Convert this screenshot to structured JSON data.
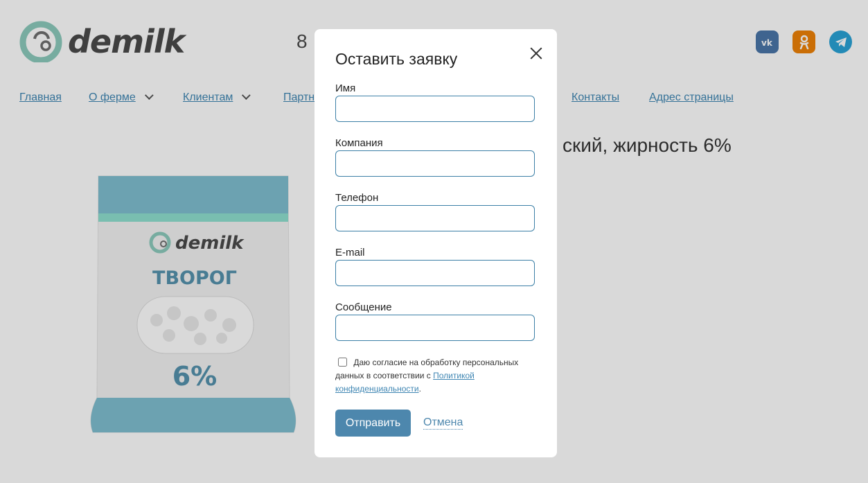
{
  "header": {
    "logo_text": "demilk",
    "phone_visible": "8",
    "socials": [
      "vk-icon",
      "ok-icon",
      "telegram-icon"
    ]
  },
  "nav": {
    "items": [
      {
        "label": "Главная",
        "has_dropdown": false
      },
      {
        "label": "О ферме",
        "has_dropdown": true
      },
      {
        "label": "Клиентам",
        "has_dropdown": true
      },
      {
        "label": "Партн",
        "has_dropdown": false
      },
      {
        "label": "Контакты",
        "has_dropdown": false
      },
      {
        "label": "Адрес страницы",
        "has_dropdown": false
      }
    ]
  },
  "product": {
    "title_visible": "ский, жирность 6%",
    "package": {
      "brand": "demilk",
      "name": "ТВОРОГ",
      "fat": "6%"
    }
  },
  "modal": {
    "title": "Оставить заявку",
    "fields": [
      {
        "label": "Имя",
        "value": "",
        "placeholder": ""
      },
      {
        "label": "Компания",
        "value": "",
        "placeholder": ""
      },
      {
        "label": "Телефон",
        "value": "",
        "placeholder": ""
      },
      {
        "label": "E-mail",
        "value": "",
        "placeholder": ""
      },
      {
        "label": "Сообщение",
        "value": "",
        "placeholder": ""
      }
    ],
    "consent": {
      "checked": false,
      "text_before": "Даю согласие на обработку персональных данных в соответствии с ",
      "link_text": "Политикой конфиденциальности",
      "text_after": "."
    },
    "submit_label": "Отправить",
    "cancel_label": "Отмена"
  },
  "colors": {
    "accent": "#4d87ad",
    "link": "#3f86b3",
    "brand_teal": "#8ccbbd",
    "overlay": "#d9d9d9"
  }
}
